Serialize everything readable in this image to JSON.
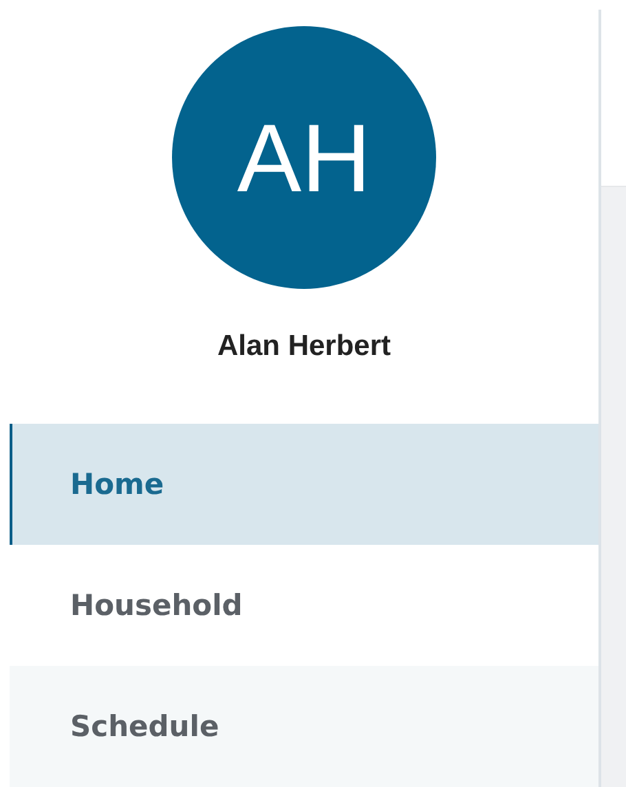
{
  "profile": {
    "initials": "AH",
    "name": "Alan Herbert"
  },
  "nav": [
    {
      "label": "Home",
      "selected": true
    },
    {
      "label": "Household",
      "selected": false
    },
    {
      "label": "Schedule",
      "selected": false
    }
  ]
}
